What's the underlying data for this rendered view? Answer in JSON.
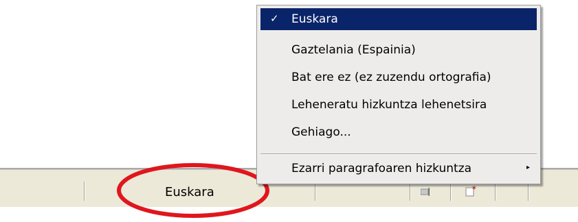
{
  "menu": {
    "items": [
      {
        "label": "Euskara",
        "checked": true
      },
      {
        "label": "Gaztelania (Espainia)"
      },
      {
        "label": "Bat ere ez (ez zuzendu ortografia)"
      },
      {
        "label": "Leheneratu hizkuntza lehenetsira"
      },
      {
        "label": "Gehiago..."
      },
      {
        "label": "Ezarri paragrafoaren hizkuntza",
        "submenu": true
      }
    ],
    "check_glyph": "✓",
    "arrow_glyph": "▸",
    "selected_color": "#0a246a"
  },
  "statusbar": {
    "language": "Euskara",
    "icons": [
      "document-icon",
      "modified-document-icon"
    ]
  },
  "annotation_color": "#e0161e"
}
